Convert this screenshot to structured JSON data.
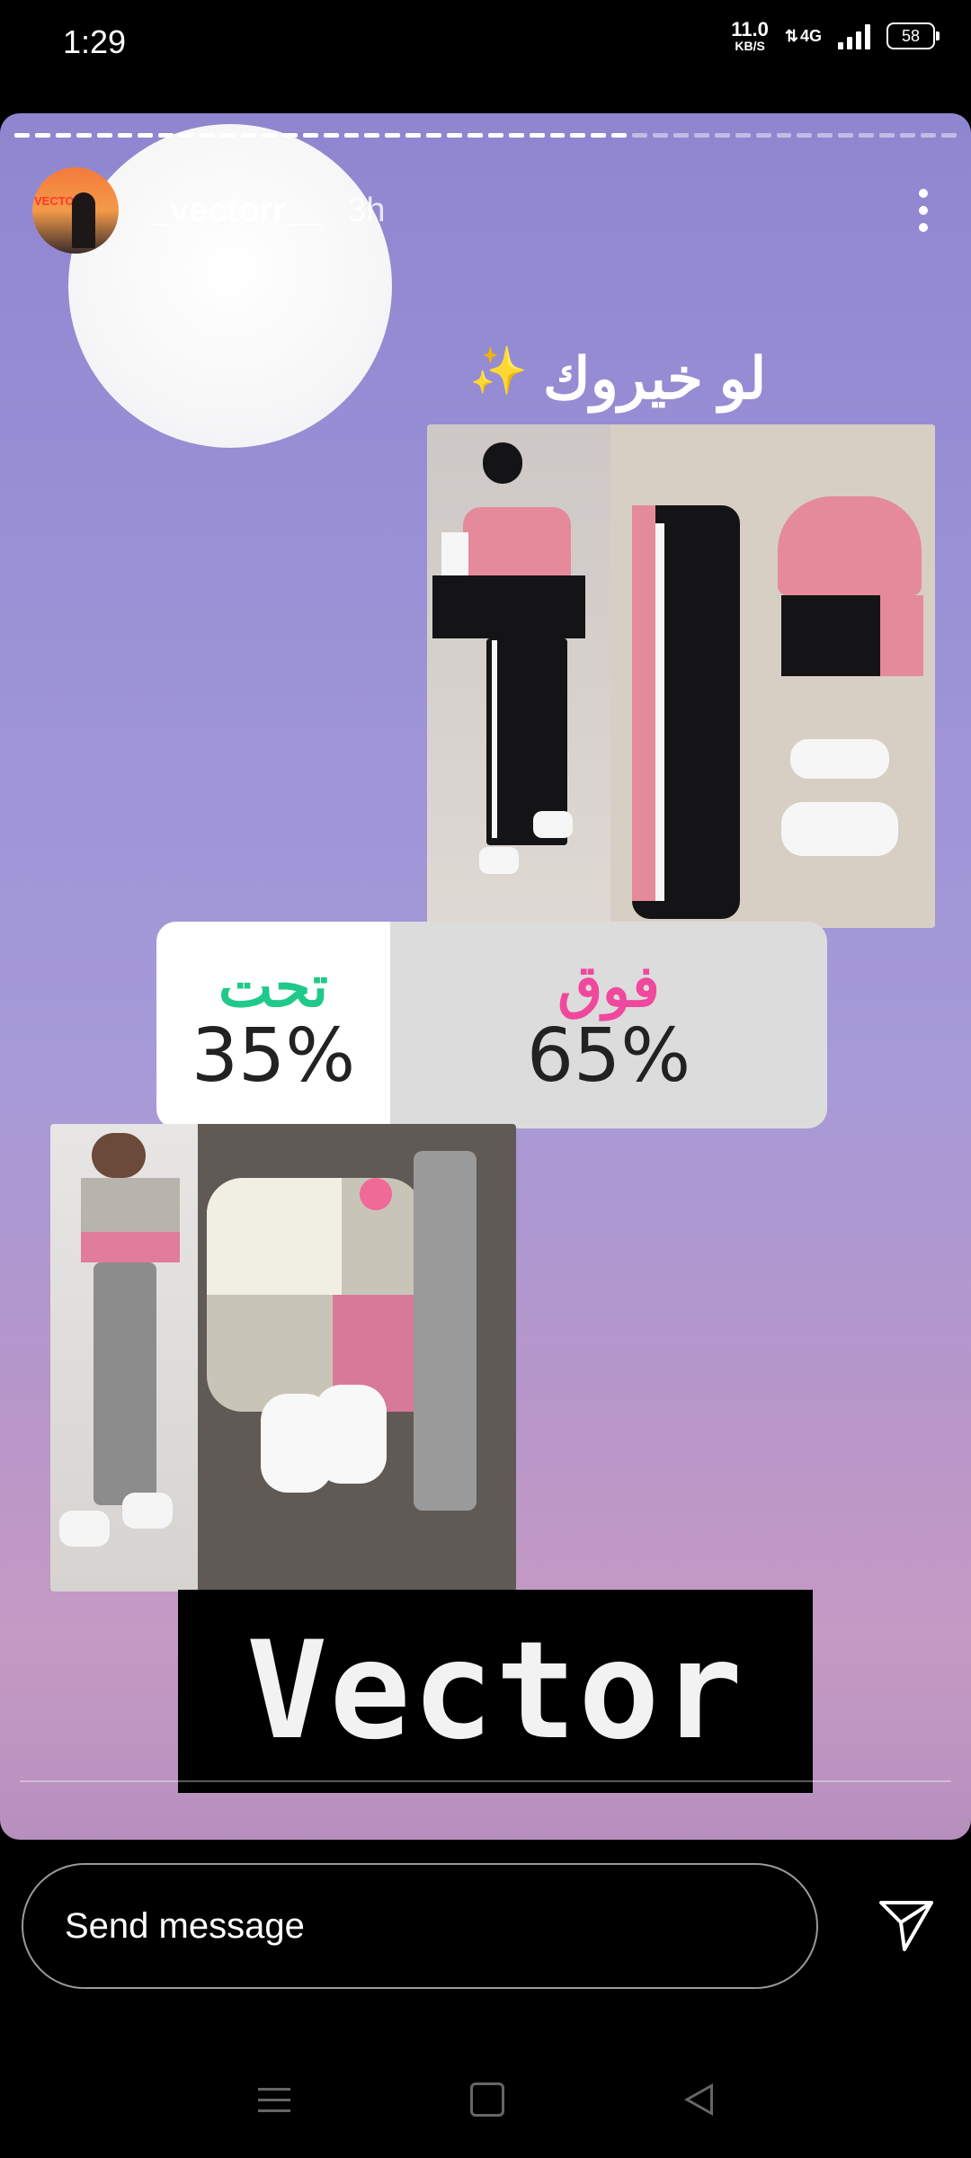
{
  "status_bar": {
    "time": "1:29",
    "net_speed_value": "11.0",
    "net_speed_unit": "KB/S",
    "net_type": "4G",
    "battery": "58"
  },
  "story": {
    "username": "_vectorr__",
    "time_ago": "3h",
    "avatar_text": "VECTOR",
    "title_arabic": "لو خيروك",
    "sparkle_icon": "✨",
    "poll": {
      "option_left": {
        "label": "تحت",
        "percent": "35%",
        "color": "#1fc98a"
      },
      "option_right": {
        "label": "فوق",
        "percent": "65%",
        "color": "#f0489c"
      }
    },
    "banner_text": "Vector"
  },
  "message_bar": {
    "placeholder": "Send message"
  },
  "icons": {
    "more": "more-vertical-icon",
    "send": "paper-plane-icon",
    "nav_menu": "menu-icon",
    "nav_home": "home-icon",
    "nav_back": "back-icon"
  }
}
